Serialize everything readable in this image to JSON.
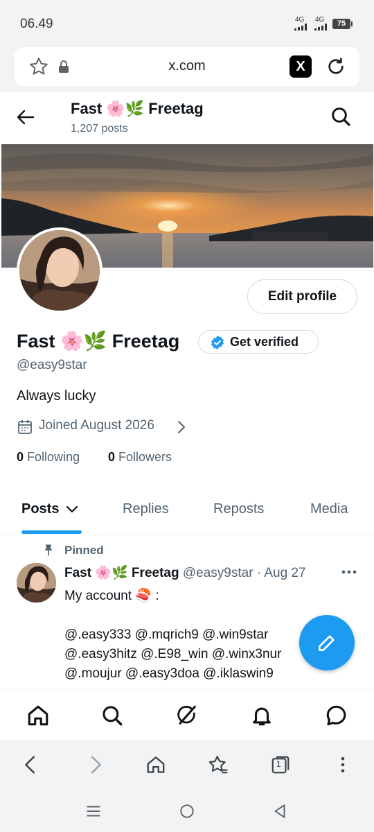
{
  "status_bar": {
    "time": "06.49",
    "network1": "4G",
    "network2": "4G",
    "battery": "75"
  },
  "browser": {
    "url": "x.com",
    "site_icon_label": "X"
  },
  "header": {
    "name": "Fast 🌸🌿 Freetag",
    "post_count": "1,207 posts"
  },
  "profile": {
    "display_name": "Fast 🌸🌿 Freetag",
    "handle": "@easy9star",
    "bio": "Always lucky",
    "joined": "Joined August 2026",
    "following_count": "0",
    "following_label": "Following",
    "followers_count": "0",
    "followers_label": "Followers",
    "edit_button": "Edit profile",
    "verify_button": "Get verified",
    "verified_color": "#1d9bf0"
  },
  "tabs": [
    {
      "label": "Posts",
      "active": true
    },
    {
      "label": "Replies",
      "active": false
    },
    {
      "label": "Reposts",
      "active": false
    },
    {
      "label": "Media",
      "active": false
    }
  ],
  "post": {
    "pinned_label": "Pinned",
    "author": "Fast 🌸🌿 Freetag",
    "handle": "@easy9star",
    "separator": "·",
    "date": "Aug 27",
    "text": "My account 🍣 :\n\n@.easy333 @.mqrich9 @.win9star\n@.easy3hitz @.E98_win @.winx3nur\n@.moujur @.easy3doa @.iklaswin9"
  },
  "bottom_nav": [
    "home-icon",
    "search-icon",
    "grok-icon",
    "notifications-icon",
    "messages-icon"
  ],
  "browser_toolbar": {
    "tab_count": "1"
  },
  "colors": {
    "accent": "#1d9bf0",
    "muted_text": "#536471",
    "text": "#0f1419"
  }
}
